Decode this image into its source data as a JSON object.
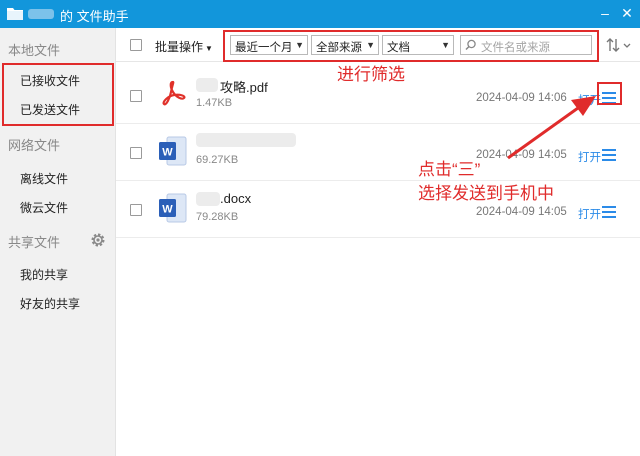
{
  "window": {
    "title": "的 文件助手",
    "minimize_label": "–",
    "close_label": "✕"
  },
  "sidebar": {
    "local_header": "本地文件",
    "received": "已接收文件",
    "sent": "已发送文件",
    "network_header": "网络文件",
    "offline": "离线文件",
    "weiyun": "微云文件",
    "shared_header": "共享文件",
    "my_share": "我的共享",
    "friend_share": "好友的共享"
  },
  "toolbar": {
    "batch_label": "批量操作",
    "batch_caret": "▼",
    "filters": [
      {
        "value": "最近一个月"
      },
      {
        "value": "全部来源"
      },
      {
        "value": "文档"
      }
    ],
    "select_arrow": "▼",
    "search_placeholder": "文件名或来源"
  },
  "files": [
    {
      "name": "攻略.pdf",
      "size": "1.47KB",
      "date": "2024-04-09 14:06",
      "open": "打开",
      "type": "pdf"
    },
    {
      "name": "",
      "size": "69.27KB",
      "date": "2024-04-09 14:05",
      "open": "打开",
      "type": "word"
    },
    {
      "name": ".docx",
      "size": "79.28KB",
      "date": "2024-04-09 14:05",
      "open": "打开",
      "type": "word"
    }
  ],
  "annotations": {
    "filter_note": "进行筛选",
    "click_note": "点击“三”",
    "send_note": "选择发送到手机中"
  },
  "colors": {
    "titlebar": "#1296db",
    "accent_link": "#2b8be8",
    "annotation_red": "#e02b2b",
    "pdf_red": "#e0312a",
    "word_blue": "#2b5fb8"
  }
}
